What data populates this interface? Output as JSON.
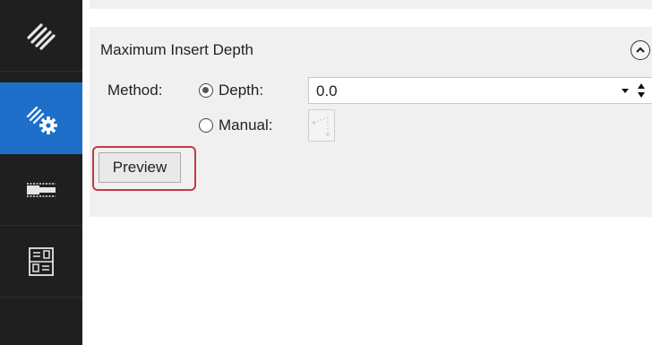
{
  "sidebar": {
    "items": [
      {
        "icon": "toolpath-icon",
        "active": false
      },
      {
        "icon": "toolpath-settings-icon",
        "active": true
      },
      {
        "icon": "tool-icon",
        "active": false
      },
      {
        "icon": "parameters-icon",
        "active": false
      }
    ]
  },
  "panel": {
    "title": "Maximum Insert Depth",
    "method_label": "Method:",
    "depth_label": "Depth:",
    "depth_value": "0.0",
    "manual_label": "Manual:",
    "preview_label": "Preview",
    "selected_method": "Depth"
  },
  "colors": {
    "sidebar_bg": "#1f1f1f",
    "active_item": "#1d6fc9",
    "panel_bg": "#f0f0f0",
    "highlight_border": "#c0394b"
  }
}
